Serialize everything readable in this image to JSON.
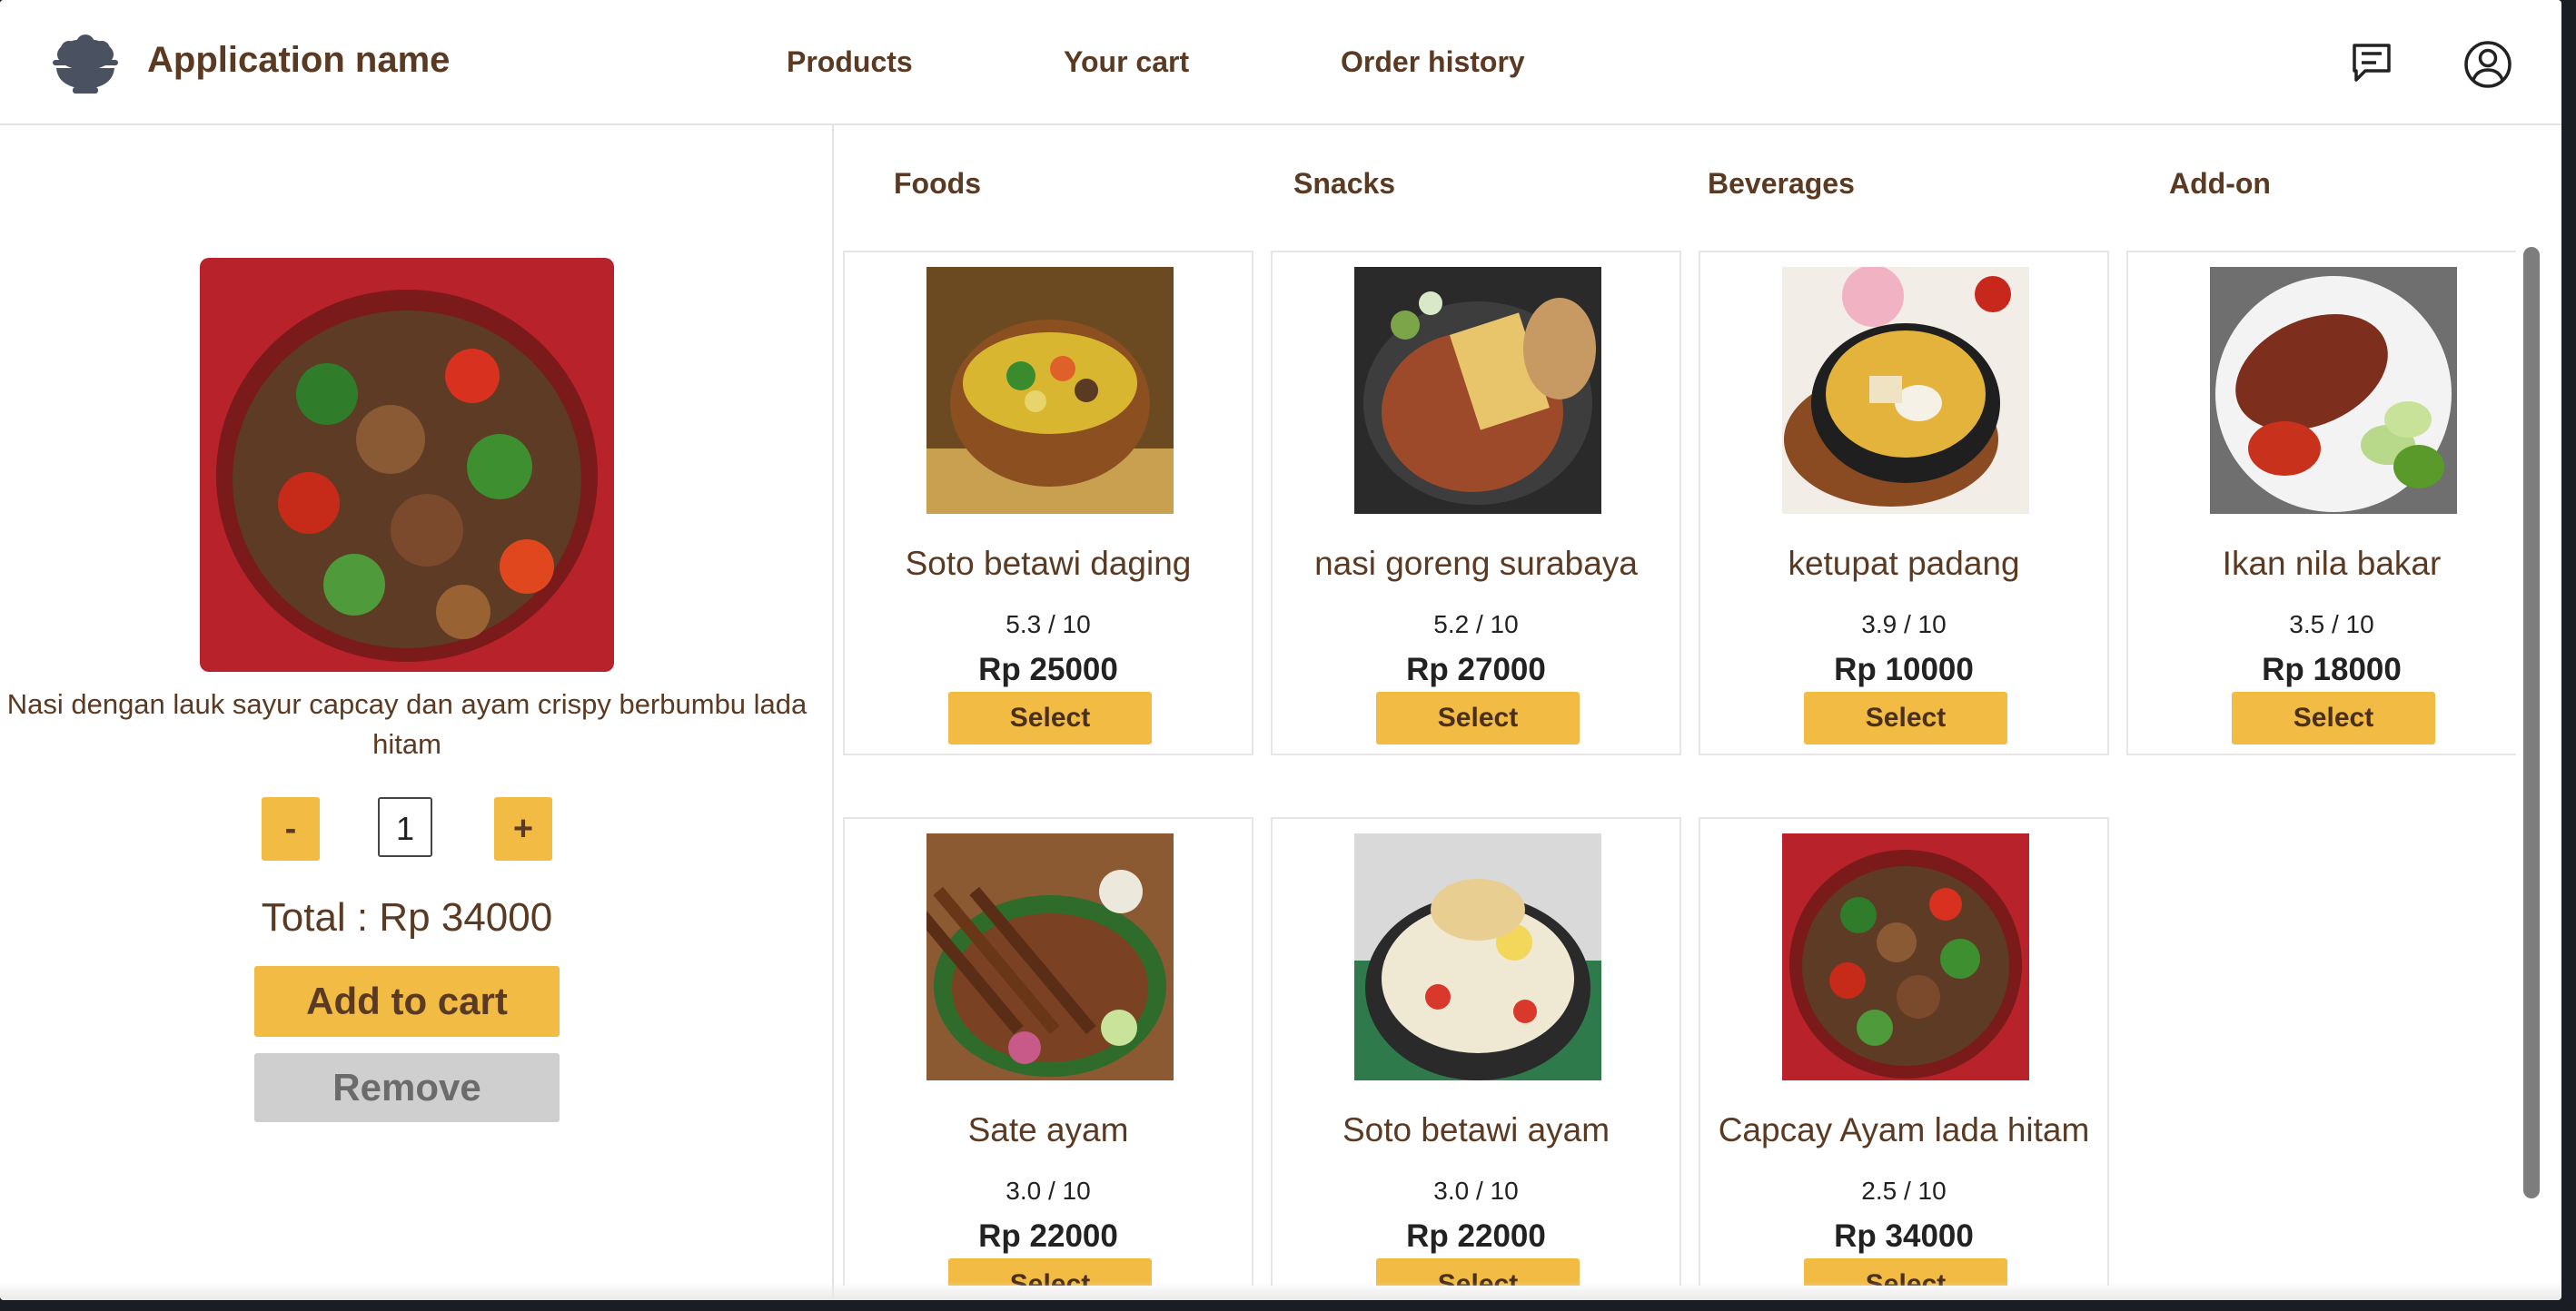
{
  "app": {
    "name": "Application name"
  },
  "nav": {
    "products": "Products",
    "cart": "Your cart",
    "history": "Order history"
  },
  "detail": {
    "image": "capcay-ayam-photo",
    "description": "Nasi dengan lauk sayur capcay dan ayam crispy berbumbu lada hitam",
    "minus": "-",
    "plus": "+",
    "quantity": "1",
    "total": "Total : Rp 34000",
    "add_label": "Add to cart",
    "remove_label": "Remove"
  },
  "categories": [
    "Foods",
    "Snacks",
    "Beverages",
    "Add-on"
  ],
  "products": [
    {
      "name": "Soto betawi daging",
      "rating": "5.3 / 10",
      "price": "Rp 25000",
      "button": "Select"
    },
    {
      "name": "nasi goreng surabaya",
      "rating": "5.2 / 10",
      "price": "Rp 27000",
      "button": "Select"
    },
    {
      "name": "ketupat padang",
      "rating": "3.9 / 10",
      "price": "Rp 10000",
      "button": "Select"
    },
    {
      "name": "Ikan nila bakar",
      "rating": "3.5 / 10",
      "price": "Rp 18000",
      "button": "Select"
    },
    {
      "name": "Sate ayam",
      "rating": "3.0 / 10",
      "price": "Rp 22000",
      "button": "Select"
    },
    {
      "name": "Soto betawi ayam",
      "rating": "3.0 / 10",
      "price": "Rp 22000",
      "button": "Select"
    },
    {
      "name": "Capcay Ayam lada hitam",
      "rating": "2.5 / 10",
      "price": "Rp 34000",
      "button": "Select"
    }
  ],
  "colors": {
    "accent": "#f2bb44",
    "text": "#5a3a22",
    "remove": "#cfcfcf",
    "logo": "#4a5160"
  },
  "icons": {
    "logo": "rice-bowl-icon",
    "chat": "chat-icon",
    "account": "user-icon"
  }
}
